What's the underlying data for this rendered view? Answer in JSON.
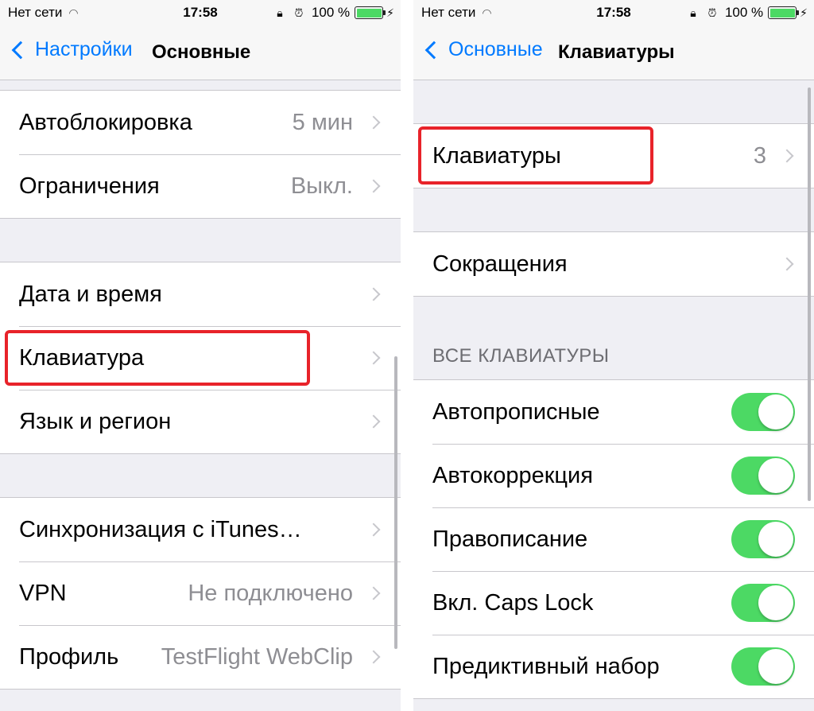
{
  "status_bar": {
    "carrier": "Нет сети",
    "time": "17:58",
    "battery": "100 %",
    "icons": [
      "wifi-icon",
      "rotation-lock-icon",
      "alarm-icon",
      "battery-icon",
      "charging-bolt-icon"
    ]
  },
  "left": {
    "nav": {
      "back_label": "Настройки",
      "title": "Основные"
    },
    "groups": [
      [
        {
          "label": "Автоблокировка",
          "value": "5 мин"
        },
        {
          "label": "Ограничения",
          "value": "Выкл."
        }
      ],
      [
        {
          "label": "Дата и время",
          "value": ""
        },
        {
          "label": "Клавиатура",
          "value": ""
        },
        {
          "label": "Язык и регион",
          "value": ""
        }
      ],
      [
        {
          "label": "Синхронизация с iTunes…",
          "value": ""
        },
        {
          "label": "VPN",
          "value": "Не подключено"
        },
        {
          "label": "Профиль",
          "value": "TestFlight WebClip"
        }
      ]
    ]
  },
  "right": {
    "nav": {
      "back_label": "Основные",
      "title": "Клавиатуры"
    },
    "keyboards_row": {
      "label": "Клавиатуры",
      "value": "3"
    },
    "shortcuts_row": {
      "label": "Сокращения"
    },
    "section_header": "ВСЕ КЛАВИАТУРЫ",
    "toggles": [
      {
        "label": "Автопрописные",
        "on": true
      },
      {
        "label": "Автокоррекция",
        "on": true
      },
      {
        "label": "Правописание",
        "on": true
      },
      {
        "label": "Вкл. Caps Lock",
        "on": true
      },
      {
        "label": "Предиктивный набор",
        "on": true
      }
    ]
  },
  "colors": {
    "accent": "#007aff",
    "switch_on": "#4cd964",
    "highlight": "#e8232a",
    "background": "#efeff4"
  }
}
